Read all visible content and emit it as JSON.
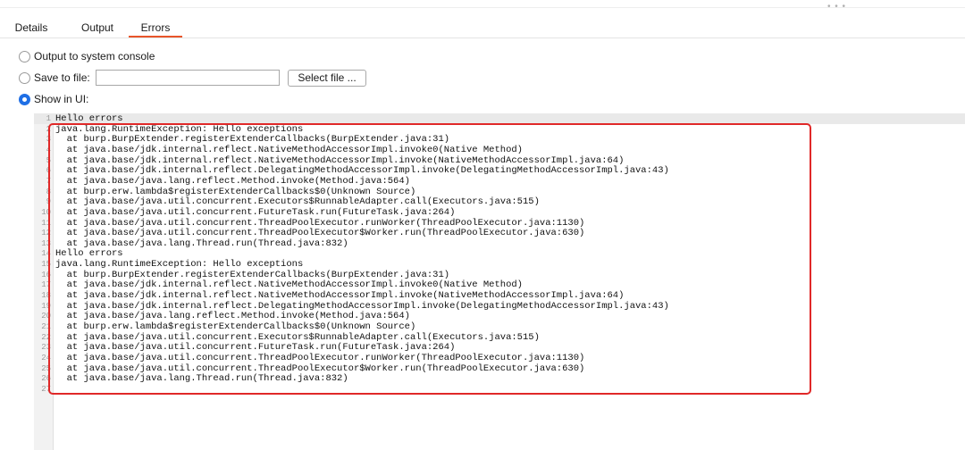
{
  "tabs": [
    {
      "label": "Details",
      "active": false
    },
    {
      "label": "Output",
      "active": false
    },
    {
      "label": "Errors",
      "active": true
    }
  ],
  "options": {
    "system_console": {
      "label": "Output to system console",
      "selected": false
    },
    "save_to_file": {
      "label": "Save to file:",
      "selected": false,
      "value": "",
      "button_label": "Select file ..."
    },
    "show_in_ui": {
      "label": "Show in UI:",
      "selected": true
    }
  },
  "colors": {
    "accent": "#1f6fe5",
    "active_tab_underline": "#e8552a",
    "highlight_border": "#e02828"
  },
  "editor": {
    "lines": [
      {
        "no": "1",
        "text": "Hello errors"
      },
      {
        "no": "2",
        "text": "java.lang.RuntimeException: Hello exceptions"
      },
      {
        "no": "3",
        "text": "  at burp.BurpExtender.registerExtenderCallbacks(BurpExtender.java:31)"
      },
      {
        "no": "4",
        "text": "  at java.base/jdk.internal.reflect.NativeMethodAccessorImpl.invoke0(Native Method)"
      },
      {
        "no": "5",
        "text": "  at java.base/jdk.internal.reflect.NativeMethodAccessorImpl.invoke(NativeMethodAccessorImpl.java:64)"
      },
      {
        "no": "6",
        "text": "  at java.base/jdk.internal.reflect.DelegatingMethodAccessorImpl.invoke(DelegatingMethodAccessorImpl.java:43)"
      },
      {
        "no": "7",
        "text": "  at java.base/java.lang.reflect.Method.invoke(Method.java:564)"
      },
      {
        "no": "8",
        "text": "  at burp.erw.lambda$registerExtenderCallbacks$0(Unknown Source)"
      },
      {
        "no": "9",
        "text": "  at java.base/java.util.concurrent.Executors$RunnableAdapter.call(Executors.java:515)"
      },
      {
        "no": "10",
        "text": "  at java.base/java.util.concurrent.FutureTask.run(FutureTask.java:264)"
      },
      {
        "no": "11",
        "text": "  at java.base/java.util.concurrent.ThreadPoolExecutor.runWorker(ThreadPoolExecutor.java:1130)"
      },
      {
        "no": "12",
        "text": "  at java.base/java.util.concurrent.ThreadPoolExecutor$Worker.run(ThreadPoolExecutor.java:630)"
      },
      {
        "no": "13",
        "text": "  at java.base/java.lang.Thread.run(Thread.java:832)"
      },
      {
        "no": "14",
        "text": "Hello errors"
      },
      {
        "no": "15",
        "text": "java.lang.RuntimeException: Hello exceptions"
      },
      {
        "no": "16",
        "text": "  at burp.BurpExtender.registerExtenderCallbacks(BurpExtender.java:31)"
      },
      {
        "no": "17",
        "text": "  at java.base/jdk.internal.reflect.NativeMethodAccessorImpl.invoke0(Native Method)"
      },
      {
        "no": "18",
        "text": "  at java.base/jdk.internal.reflect.NativeMethodAccessorImpl.invoke(NativeMethodAccessorImpl.java:64)"
      },
      {
        "no": "19",
        "text": "  at java.base/jdk.internal.reflect.DelegatingMethodAccessorImpl.invoke(DelegatingMethodAccessorImpl.java:43)"
      },
      {
        "no": "20",
        "text": "  at java.base/java.lang.reflect.Method.invoke(Method.java:564)"
      },
      {
        "no": "21",
        "text": "  at burp.erw.lambda$registerExtenderCallbacks$0(Unknown Source)"
      },
      {
        "no": "22",
        "text": "  at java.base/java.util.concurrent.Executors$RunnableAdapter.call(Executors.java:515)"
      },
      {
        "no": "23",
        "text": "  at java.base/java.util.concurrent.FutureTask.run(FutureTask.java:264)"
      },
      {
        "no": "24",
        "text": "  at java.base/java.util.concurrent.ThreadPoolExecutor.runWorker(ThreadPoolExecutor.java:1130)"
      },
      {
        "no": "25",
        "text": "  at java.base/java.util.concurrent.ThreadPoolExecutor$Worker.run(ThreadPoolExecutor.java:630)"
      },
      {
        "no": "26",
        "text": "  at java.base/java.lang.Thread.run(Thread.java:832)"
      },
      {
        "no": "27",
        "text": ""
      }
    ]
  }
}
